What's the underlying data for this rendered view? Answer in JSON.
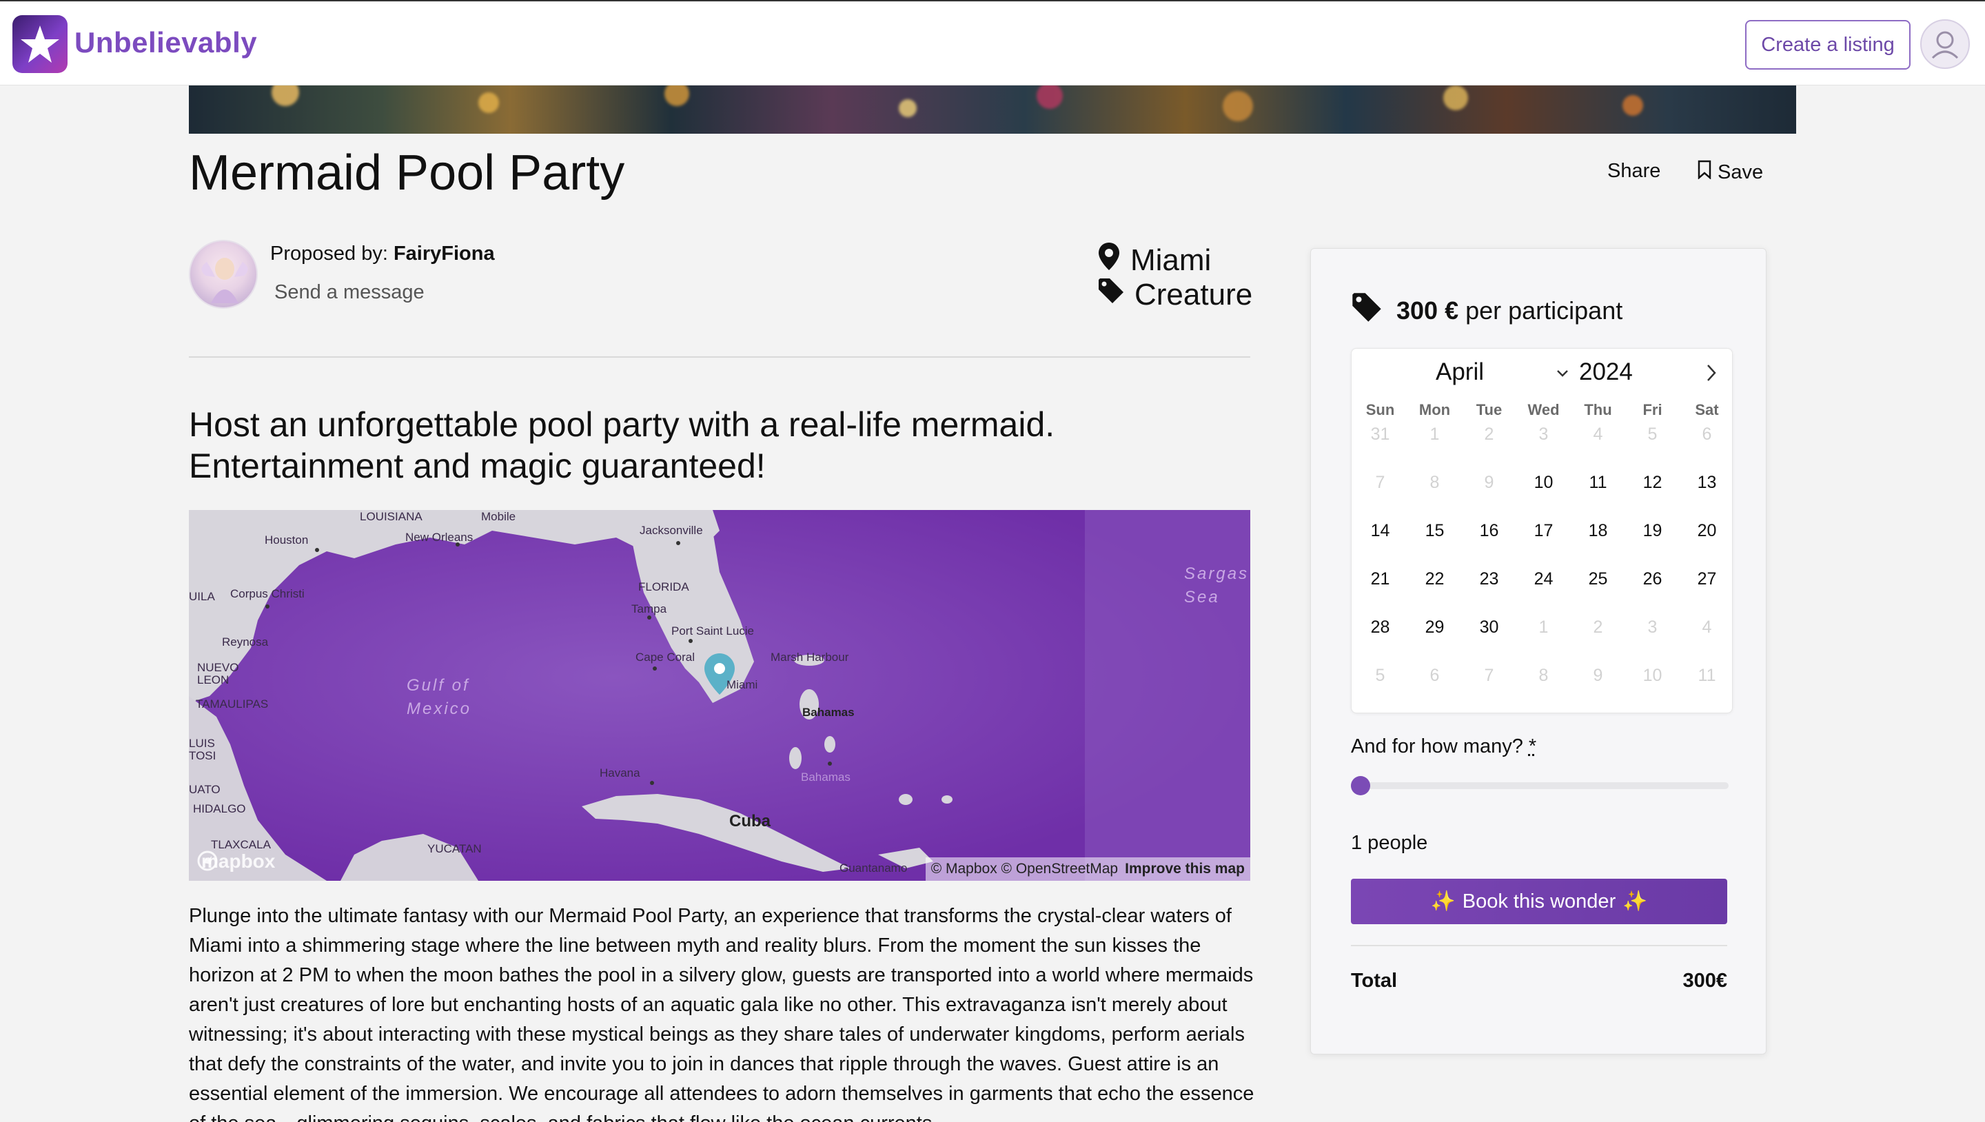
{
  "header": {
    "brand": "Unbelievably",
    "create_listing": "Create a listing",
    "logo_icon": "star-icon",
    "avatar_icon": "user-avatar-icon"
  },
  "listing": {
    "title": "Mermaid Pool Party",
    "share_label": "Share",
    "save_label": "Save",
    "proposed_prefix": "Proposed by: ",
    "host_name": "FairyFiona",
    "send_message": "Send a message",
    "location": "Miami",
    "category": "Creature",
    "tagline": "Host an unforgettable pool party with a real-life mermaid. Entertainment and magic guaranteed!",
    "description": "Plunge into the ultimate fantasy with our Mermaid Pool Party, an experience that transforms the crystal-clear waters of Miami into a shimmering stage where the line between myth and reality blurs. From the moment the sun kisses the horizon at 2 PM to when the moon bathes the pool in a silvery glow, guests are transported into a world where mermaids aren't just creatures of lore but enchanting hosts of an aquatic gala like no other. This extravaganza isn't merely about witnessing; it's about interacting with these mystical beings as they share tales of underwater kingdoms, perform aerials that defy the constraints of the water, and invite you to join in dances that ripple through the waves. Guest attire is an essential element of the immersion. We encourage all attendees to adorn themselves in garments that echo the essence of the sea—glimmering sequins, scales, and fabrics that flow like the ocean currents."
  },
  "map": {
    "labels": {
      "louisiana": "LOUISIANA",
      "mobile": "Mobile",
      "jacksonville": "Jacksonville",
      "houston": "Houston",
      "new_orleans": "New Orleans",
      "florida": "FLORIDA",
      "corpus_christi": "Corpus Christi",
      "uila": "UILA",
      "tampa": "Tampa",
      "port_saint_lucie": "Port Saint Lucie",
      "reynosa": "Reynosa",
      "cape_coral": "Cape Coral",
      "marsh_harbour": "Marsh Harbour",
      "nuevo_leon": "NUEVO\nLEON",
      "miami": "Miami",
      "tamaulipas": "TAMAULIPAS",
      "bahamas": "Bahamas",
      "bahamas2": "Bahamas",
      "luis_potosi": "LUIS\nTOSI",
      "havana": "Havana",
      "uato": "UATO",
      "hidalgo": "HIDALGO",
      "cuba": "Cuba",
      "tlaxcala": "TLAXCALA",
      "yucatan": "YUCATAN",
      "guantanamo": "Guantanamo",
      "gulf": "Gulf of\nMexico",
      "sargasso": "Sargas\nSea"
    },
    "mapbox_logo": "mapbox",
    "attribution": "© Mapbox © OpenStreetMap",
    "improve": "Improve this map"
  },
  "booking": {
    "price_amount": "300 €",
    "price_suffix": " per participant",
    "calendar": {
      "month": "April",
      "year": "2024",
      "weekdays": [
        "Sun",
        "Mon",
        "Tue",
        "Wed",
        "Thu",
        "Fri",
        "Sat"
      ],
      "weeks": [
        [
          "31",
          "1",
          "2",
          "3",
          "4",
          "5",
          "6"
        ],
        [
          "7",
          "8",
          "9",
          "10",
          "11",
          "12",
          "13"
        ],
        [
          "14",
          "15",
          "16",
          "17",
          "18",
          "19",
          "20"
        ],
        [
          "21",
          "22",
          "23",
          "24",
          "25",
          "26",
          "27"
        ],
        [
          "28",
          "29",
          "30",
          "1",
          "2",
          "3",
          "4"
        ],
        [
          "5",
          "6",
          "7",
          "8",
          "9",
          "10",
          "11"
        ]
      ],
      "muted": [
        [
          true,
          true,
          true,
          true,
          true,
          true,
          true
        ],
        [
          true,
          true,
          true,
          false,
          false,
          false,
          false
        ],
        [
          false,
          false,
          false,
          false,
          false,
          false,
          false
        ],
        [
          false,
          false,
          false,
          false,
          false,
          false,
          false
        ],
        [
          false,
          false,
          false,
          true,
          true,
          true,
          true
        ],
        [
          true,
          true,
          true,
          true,
          true,
          true,
          true
        ]
      ]
    },
    "how_many_label": "And for how many? ",
    "required_mark": "*",
    "participants": 1,
    "people_label": "1 people",
    "book_button": "Book this wonder",
    "sparkle": "✨",
    "total_label": "Total",
    "total_value": "300€"
  },
  "colors": {
    "brand": "#7c4bbf",
    "accent": "#7b46b4",
    "map_sea": "#7c3fb4"
  }
}
